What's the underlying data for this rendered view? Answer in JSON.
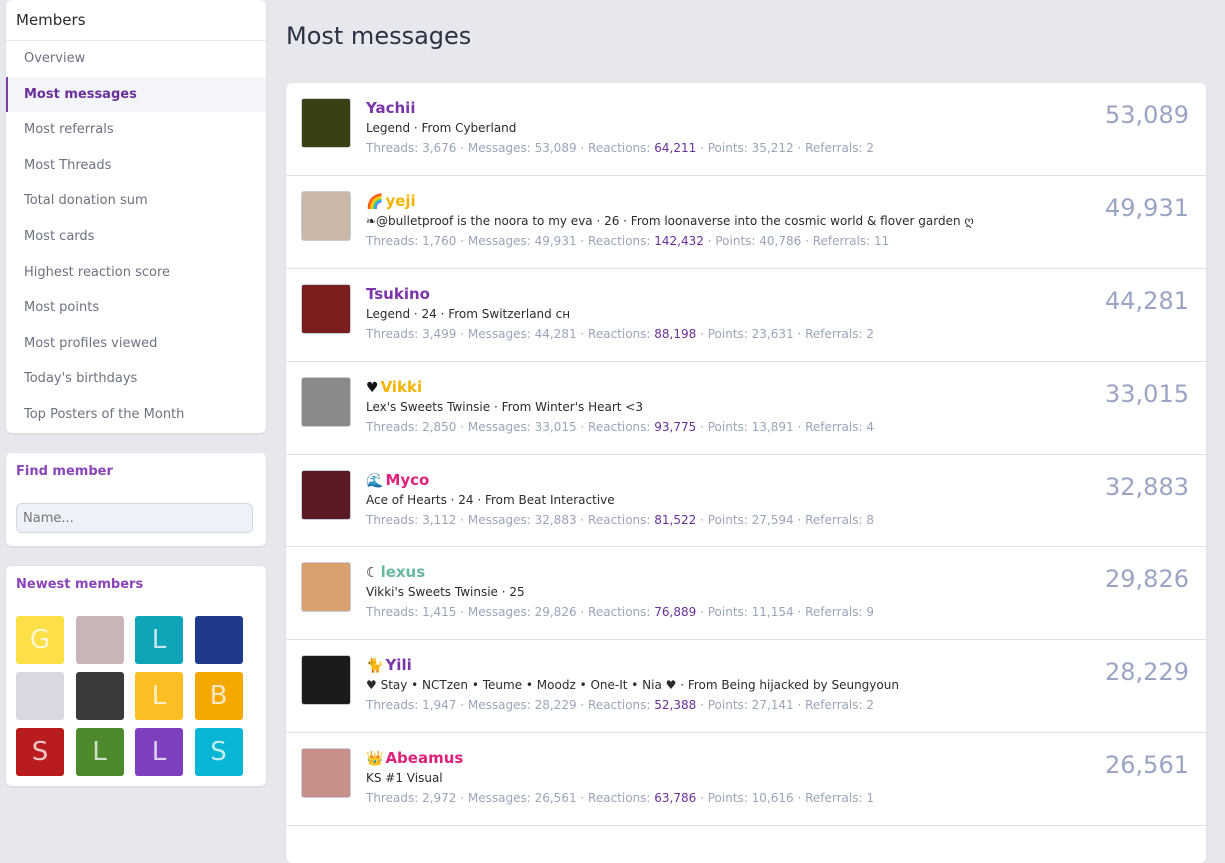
{
  "sidebar": {
    "title": "Members",
    "items": [
      {
        "label": "Overview"
      },
      {
        "label": "Most messages"
      },
      {
        "label": "Most referrals"
      },
      {
        "label": "Most Threads"
      },
      {
        "label": "Total donation sum"
      },
      {
        "label": "Most cards"
      },
      {
        "label": "Highest reaction score"
      },
      {
        "label": "Most points"
      },
      {
        "label": "Most profiles viewed"
      },
      {
        "label": "Today's birthdays"
      },
      {
        "label": "Top Posters of the Month"
      }
    ],
    "selected": "Most messages"
  },
  "find_member": {
    "title": "Find member",
    "placeholder": "Name..."
  },
  "newest_members": {
    "title": "Newest members",
    "avatars": [
      {
        "letter": "G",
        "color": "#fde047"
      },
      {
        "letter": "",
        "color": "#c8b5b8"
      },
      {
        "letter": "L",
        "color": "#0ea5b8"
      },
      {
        "letter": "",
        "color": "#1f3a8a"
      },
      {
        "letter": "",
        "color": "#d8d8e0"
      },
      {
        "letter": "",
        "color": "#3a3a3a"
      },
      {
        "letter": "L",
        "color": "#fbbf24"
      },
      {
        "letter": "B",
        "color": "#f5a800"
      },
      {
        "letter": "S",
        "color": "#b91c1c"
      },
      {
        "letter": "L",
        "color": "#4d8a2b"
      },
      {
        "letter": "L",
        "color": "#7e3fbf"
      },
      {
        "letter": "S",
        "color": "#06b6d4"
      }
    ]
  },
  "main": {
    "title": "Most messages",
    "labels": {
      "threads": "Threads: ",
      "messages": "Messages: ",
      "reactions": "Reactions: ",
      "points": "Points: ",
      "referrals": "Referrals: "
    },
    "members": [
      {
        "name": "Yachii",
        "name_color": "#7a35a8",
        "badge": "",
        "title": "Legend · From Cyberland",
        "threads": "3,676",
        "messages": "53,089",
        "reactions": "64,211",
        "points": "35,212",
        "referrals": "2",
        "count": "53,089",
        "avatar_color": "#3b3f14"
      },
      {
        "name": "yeji",
        "name_color": "#f4b400",
        "badge": "🌈",
        "title": "❧@bulletproof is the noora to my eva · 26 · From loonaverse into the cosmic world & flover garden ღ",
        "threads": "1,760",
        "messages": "49,931",
        "reactions": "142,432",
        "points": "40,786",
        "referrals": "11",
        "count": "49,931",
        "avatar_color": "#c9b8a8"
      },
      {
        "name": "Tsukino",
        "name_color": "#7a35a8",
        "badge": "",
        "title": "Legend · 24 · From Switzerland ᴄʜ",
        "threads": "3,499",
        "messages": "44,281",
        "reactions": "88,198",
        "points": "23,631",
        "referrals": "2",
        "count": "44,281",
        "avatar_color": "#7a1e1e"
      },
      {
        "name": "Vikki",
        "name_color": "#f4b400",
        "badge": "♥",
        "title": "Lex's Sweets Twinsie · From Winter's Heart <3",
        "threads": "2,850",
        "messages": "33,015",
        "reactions": "93,775",
        "points": "13,891",
        "referrals": "4",
        "count": "33,015",
        "avatar_color": "#8a8a8a"
      },
      {
        "name": "Myco",
        "name_color": "#e0217a",
        "badge": "🌊",
        "title": "Ace of Hearts · 24 · From Beat Interactive",
        "threads": "3,112",
        "messages": "32,883",
        "reactions": "81,522",
        "points": "27,594",
        "referrals": "8",
        "count": "32,883",
        "avatar_color": "#5a1a22"
      },
      {
        "name": "lexus",
        "name_color": "#6ab8a0",
        "badge": "☾",
        "title": "Vikki's Sweets Twinsie · 25",
        "threads": "1,415",
        "messages": "29,826",
        "reactions": "76,889",
        "points": "11,154",
        "referrals": "9",
        "count": "29,826",
        "avatar_color": "#d9a070"
      },
      {
        "name": "Yili",
        "name_color": "#7a35a8",
        "badge": "🐈",
        "title": "♥ Stay • NCTzen • Teume • Moodz • One-It • Nia ♥ · From Being hijacked by Seungyoun",
        "threads": "1,947",
        "messages": "28,229",
        "reactions": "52,388",
        "points": "27,141",
        "referrals": "2",
        "count": "28,229",
        "avatar_color": "#1a1a1a"
      },
      {
        "name": "Abeamus",
        "name_color": "#e0217a",
        "badge": "👑",
        "title": "KS #1 Visual",
        "threads": "2,972",
        "messages": "26,561",
        "reactions": "63,786",
        "points": "10,616",
        "referrals": "1",
        "count": "26,561",
        "avatar_color": "#c8908a"
      }
    ]
  }
}
